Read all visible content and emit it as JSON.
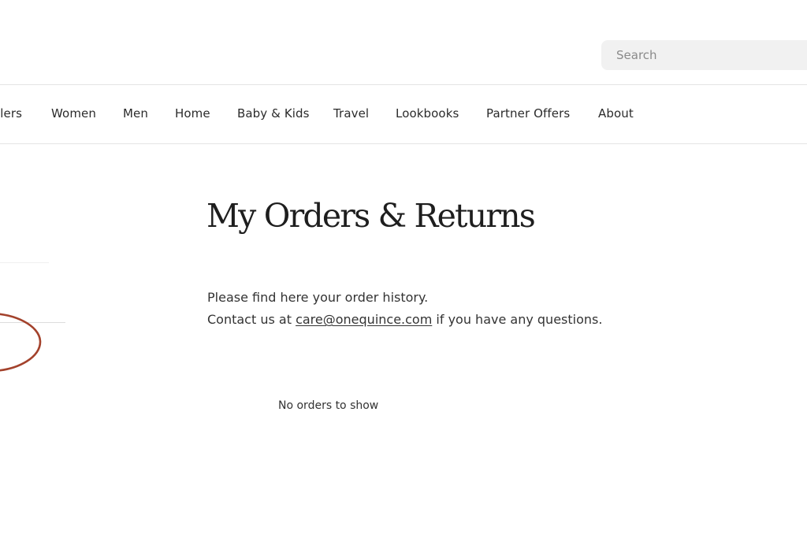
{
  "header": {
    "search": {
      "placeholder": "Search",
      "value": ""
    }
  },
  "nav": {
    "items": [
      {
        "label": "llers"
      },
      {
        "label": "Women"
      },
      {
        "label": "Men"
      },
      {
        "label": "Home"
      },
      {
        "label": "Baby & Kids"
      },
      {
        "label": "Travel"
      },
      {
        "label": "Lookbooks"
      },
      {
        "label": "Partner Offers"
      },
      {
        "label": "About"
      }
    ]
  },
  "main": {
    "title": "My Orders & Returns",
    "description_line1": "Please find here your order history.",
    "contact_prefix": "Contact us at",
    "contact_email": "care@onequince.com",
    "contact_suffix": "if you have any questions.",
    "empty_state": "No orders to show"
  },
  "colors": {
    "annotation": "#a3422c",
    "text": "#2b2b2b",
    "search_bg": "#f1f1f1",
    "divider": "#e4e4e4"
  }
}
